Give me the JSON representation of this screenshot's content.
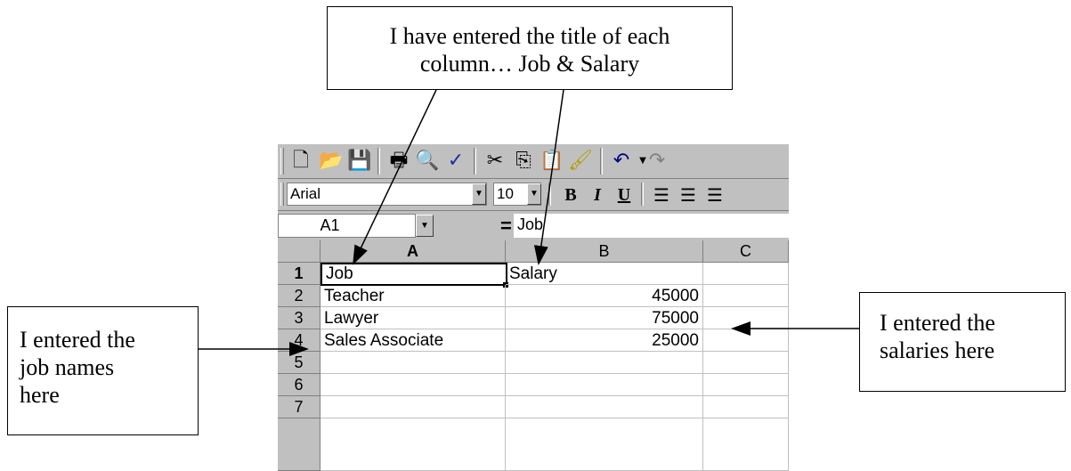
{
  "callouts": {
    "top": {
      "line1": "I have entered the title of each",
      "line2": "column… Job & Salary"
    },
    "left": {
      "line1": "I entered the",
      "line2": "job names",
      "line3": "here"
    },
    "right": {
      "line1": "I entered the",
      "line2": "salaries here"
    }
  },
  "toolbar": {
    "icons": [
      "new-file-icon",
      "open-folder-icon",
      "save-disk-icon",
      "print-icon",
      "print-preview-icon",
      "spelling-icon",
      "cut-icon",
      "copy-icon",
      "paste-icon",
      "format-painter-icon",
      "undo-icon",
      "redo-icon"
    ]
  },
  "format_toolbar": {
    "font": "Arial",
    "font_size": "10",
    "bold": "B",
    "italic": "I",
    "underline": "U"
  },
  "formula_bar": {
    "name_box": "A1",
    "equals": "=",
    "formula": "Job"
  },
  "sheet": {
    "columns": [
      "A",
      "B",
      "C"
    ],
    "rows": [
      "1",
      "2",
      "3",
      "4",
      "5",
      "6",
      "7"
    ],
    "cells": {
      "A1": "Job",
      "B1": "Salary",
      "A2": "Teacher",
      "B2": "45000",
      "A3": "Lawyer",
      "B3": "75000",
      "A4": "Sales Associate",
      "B4": "25000"
    },
    "active_cell": "A1"
  }
}
